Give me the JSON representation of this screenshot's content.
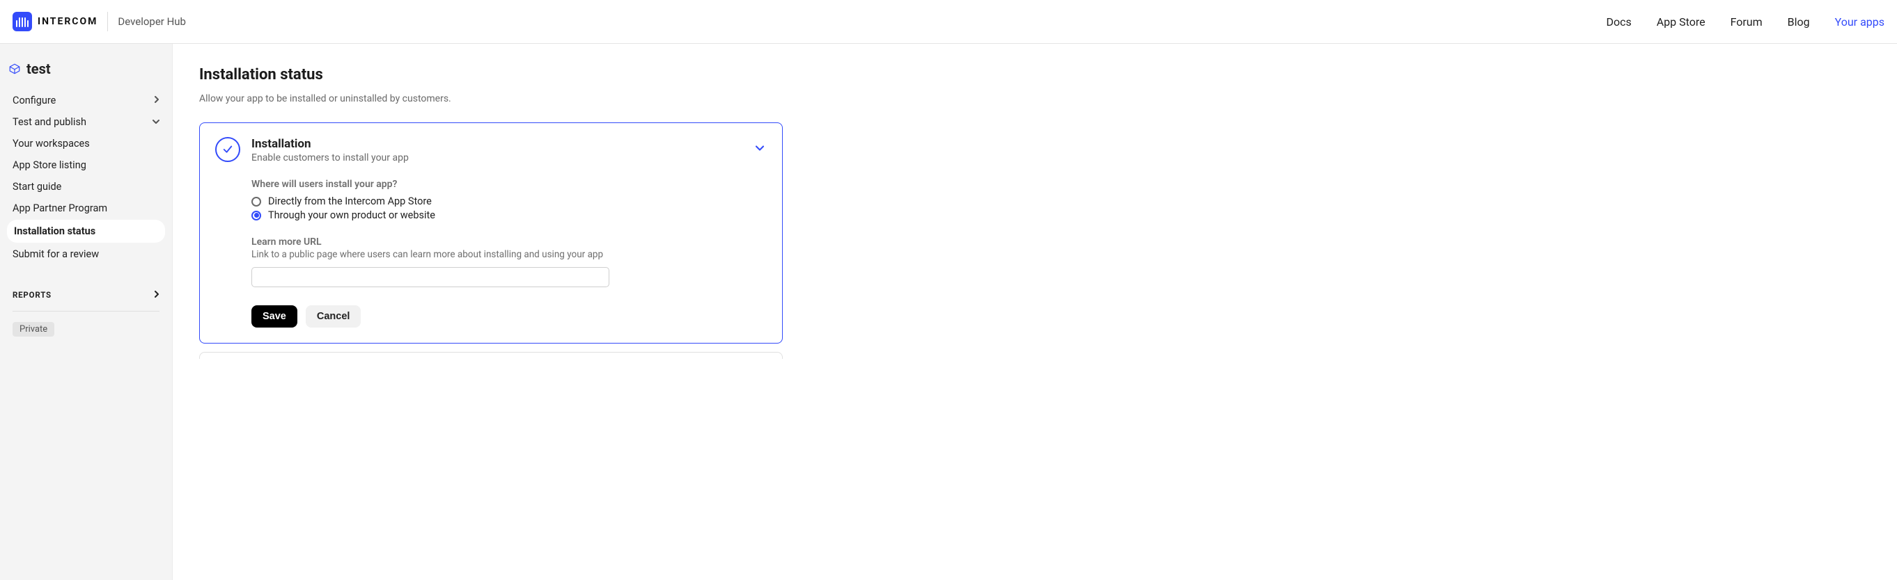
{
  "header": {
    "brand_word": "INTERCOM",
    "devhub_label": "Developer Hub",
    "nav": {
      "docs": "Docs",
      "app_store": "App Store",
      "forum": "Forum",
      "blog": "Blog",
      "your_apps": "Your apps"
    }
  },
  "sidebar": {
    "app_name": "test",
    "items": {
      "configure": "Configure",
      "test_publish": "Test and publish",
      "workspaces": "Your workspaces",
      "listing": "App Store listing",
      "start_guide": "Start guide",
      "partner_program": "App Partner Program",
      "install_status": "Installation status",
      "submit_review": "Submit for a review"
    },
    "reports_header": "REPORTS",
    "private_label": "Private"
  },
  "main": {
    "page_title": "Installation status",
    "page_subtitle": "Allow your app to be installed or uninstalled by customers.",
    "card": {
      "title": "Installation",
      "subtitle": "Enable customers to install your app",
      "question": "Where will users install your app?",
      "option_a": "Directly from the Intercom App Store",
      "option_b": "Through your own product or website",
      "selected_option": "b",
      "learn_more_label": "Learn more URL",
      "learn_more_help": "Link to a public page where users can learn more about installing and using your app",
      "learn_more_value": "",
      "save_label": "Save",
      "cancel_label": "Cancel"
    }
  }
}
